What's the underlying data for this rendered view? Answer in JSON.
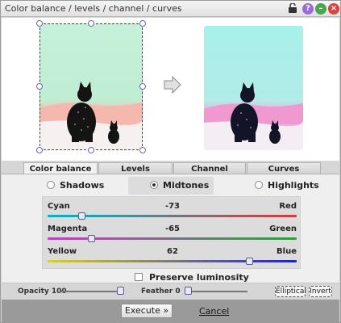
{
  "window": {
    "title": "Color balance / levels / channel / curves"
  },
  "tabs": [
    {
      "label": "Color balance",
      "active": true
    },
    {
      "label": "Levels",
      "active": false
    },
    {
      "label": "Channel",
      "active": false
    },
    {
      "label": "Curves",
      "active": false
    }
  ],
  "tones": {
    "shadows": "Shadows",
    "midtones": "Midtones",
    "highlights": "Highlights",
    "selected": "Midtones"
  },
  "sliders": [
    {
      "left": "Cyan",
      "right": "Red",
      "value": "-73",
      "min": -100,
      "max": 100,
      "position": -73
    },
    {
      "left": "Magenta",
      "right": "Green",
      "value": "-65",
      "min": -100,
      "max": 100,
      "position": -65
    },
    {
      "left": "Yellow",
      "right": "Blue",
      "value": "62",
      "min": -100,
      "max": 100,
      "position": 62
    }
  ],
  "preserve_luminosity": {
    "label": "Preserve luminosity",
    "checked": false
  },
  "tools": {
    "opacity_label": "Opacity 100",
    "opacity_value": 100,
    "feather_label": "Feather 0",
    "feather_value": 0,
    "elliptical": "Elliptical",
    "invert": "Invert"
  },
  "footer": {
    "execute": "Execute »",
    "cancel": "Cancel"
  },
  "icons": {
    "lock": "lock-icon",
    "help": "help-icon",
    "minimize": "minimize-icon",
    "close": "close-icon",
    "arrow": "arrow-right-icon"
  },
  "colors": {
    "help": "#9a6ad8",
    "minimize": "#46a84a",
    "close": "#d8443c"
  }
}
